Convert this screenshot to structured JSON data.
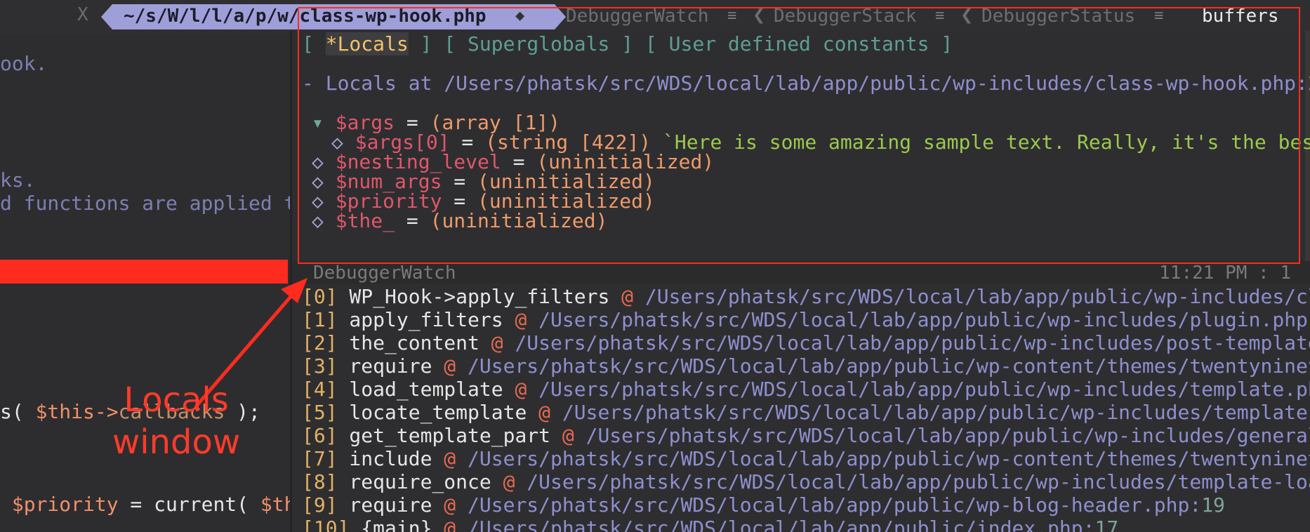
{
  "tabbar": {
    "close_label": "X",
    "active_tab": "~/s/W/l/l/a/p/w/class-wp-hook.php",
    "tabs": [
      "DebuggerWatch",
      "DebuggerStack",
      "DebuggerStatus"
    ],
    "buffers_label": "buffers",
    "menu_icon": "hamburger-menu-icon",
    "php_icon": "elephant-icon"
  },
  "left_code": {
    "line1": "ook.",
    "line2": "ks.",
    "line3": "d functions are applied t",
    "line4_pre": "s( ",
    "line4_var": "$this->",
    "line4_strike": "callbacks",
    "line4_post": " );",
    "line5_var": "$priority",
    "line5_mid": " = current( ",
    "line5_var2": "$th"
  },
  "locals": {
    "tabs": {
      "open": "[ ",
      "locals": "*Locals",
      "sep1": " ] [ ",
      "superglobals": "Superglobals",
      "sep2": " ] [ ",
      "constants": "User defined constants",
      "close": " ]"
    },
    "header_prefix": "- Locals at ",
    "header_path": "/Users/phatsk/src/WDS/local/lab/app/public/wp-includes/class-wp-hook.php:2",
    "vars": [
      {
        "marker": "▾",
        "name": "$args",
        "eq": " = ",
        "value": "(array [1])",
        "indent": 1
      },
      {
        "marker": "◇",
        "name": "$args[0]",
        "eq": " = ",
        "value": "(string [422])",
        "extra": " `Here is some amazing sample text. Really, it's the bes",
        "indent": 2
      },
      {
        "marker": "◇",
        "name": "$nesting_level",
        "eq": " = ",
        "value": "(uninitialized)",
        "indent": 1
      },
      {
        "marker": "◇",
        "name": "$num_args",
        "eq": " = ",
        "value": "(uninitialized)",
        "indent": 1
      },
      {
        "marker": "◇",
        "name": "$priority",
        "eq": " = ",
        "value": "(uninitialized)",
        "indent": 1
      },
      {
        "marker": "◇",
        "name": "$the_",
        "eq": " = ",
        "value": "(uninitialized)",
        "indent": 1
      }
    ]
  },
  "status": {
    "name": "DebuggerWatch",
    "time": "11:21 PM : 1"
  },
  "stack": [
    {
      "idx": "[0]",
      "fn": " WP_Hook->apply_filters ",
      "at": "@",
      "path": " /Users/phatsk/src/WDS/local/lab/app/public/wp-includes/cl",
      "line": ""
    },
    {
      "idx": "[1]",
      "fn": " apply_filters ",
      "at": "@",
      "path": " /Users/phatsk/src/WDS/local/lab/app/public/wp-includes/plugin.php:",
      "line": ""
    },
    {
      "idx": "[2]",
      "fn": " the_content ",
      "at": "@",
      "path": " /Users/phatsk/src/WDS/local/lab/app/public/wp-includes/post-template",
      "line": ""
    },
    {
      "idx": "[3]",
      "fn": " require ",
      "at": "@",
      "path": " /Users/phatsk/src/WDS/local/lab/app/public/wp-content/themes/twentyninet",
      "line": ""
    },
    {
      "idx": "[4]",
      "fn": " load_template ",
      "at": "@",
      "path": " /Users/phatsk/src/WDS/local/lab/app/public/wp-includes/template.ph",
      "line": ""
    },
    {
      "idx": "[5]",
      "fn": " locate_template ",
      "at": "@",
      "path": " /Users/phatsk/src/WDS/local/lab/app/public/wp-includes/template.",
      "line": ""
    },
    {
      "idx": "[6]",
      "fn": " get_template_part ",
      "at": "@",
      "path": " /Users/phatsk/src/WDS/local/lab/app/public/wp-includes/general",
      "line": ""
    },
    {
      "idx": "[7]",
      "fn": " include ",
      "at": "@",
      "path": " /Users/phatsk/src/WDS/local/lab/app/public/wp-content/themes/twentyninet",
      "line": ""
    },
    {
      "idx": "[8]",
      "fn": " require_once ",
      "at": "@",
      "path": " /Users/phatsk/src/WDS/local/lab/app/public/wp-includes/template-loa",
      "line": ""
    },
    {
      "idx": "[9]",
      "fn": " require ",
      "at": "@",
      "path": " /Users/phatsk/src/WDS/local/lab/app/public/wp-blog-header.php:",
      "line": "19"
    },
    {
      "idx": "[10]",
      "fn": " {main} ",
      "at": "@",
      "path": " /Users/phatsk/src/WDS/local/lab/app/public/index.php:",
      "line": "17"
    }
  ],
  "annotation": {
    "line1": "Locals",
    "line2": "window"
  },
  "colors": {
    "accent_tab": "#9e9fd9",
    "highlight_red": "#ff2b1f",
    "background": "#2f2f31"
  }
}
